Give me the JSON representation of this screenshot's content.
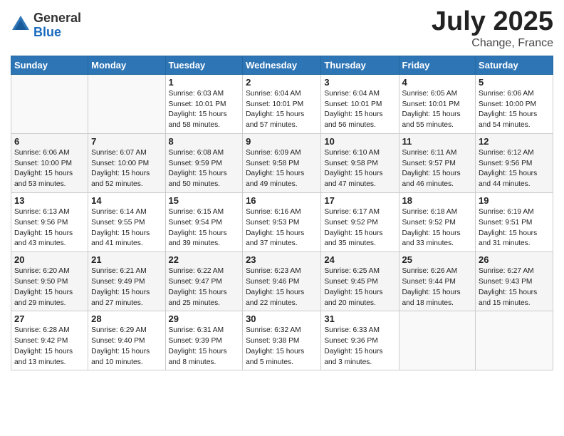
{
  "logo": {
    "general": "General",
    "blue": "Blue"
  },
  "title": "July 2025",
  "subtitle": "Change, France",
  "weekdays": [
    "Sunday",
    "Monday",
    "Tuesday",
    "Wednesday",
    "Thursday",
    "Friday",
    "Saturday"
  ],
  "weeks": [
    [
      {
        "day": "",
        "info": ""
      },
      {
        "day": "",
        "info": ""
      },
      {
        "day": "1",
        "info": "Sunrise: 6:03 AM\nSunset: 10:01 PM\nDaylight: 15 hours\nand 58 minutes."
      },
      {
        "day": "2",
        "info": "Sunrise: 6:04 AM\nSunset: 10:01 PM\nDaylight: 15 hours\nand 57 minutes."
      },
      {
        "day": "3",
        "info": "Sunrise: 6:04 AM\nSunset: 10:01 PM\nDaylight: 15 hours\nand 56 minutes."
      },
      {
        "day": "4",
        "info": "Sunrise: 6:05 AM\nSunset: 10:01 PM\nDaylight: 15 hours\nand 55 minutes."
      },
      {
        "day": "5",
        "info": "Sunrise: 6:06 AM\nSunset: 10:00 PM\nDaylight: 15 hours\nand 54 minutes."
      }
    ],
    [
      {
        "day": "6",
        "info": "Sunrise: 6:06 AM\nSunset: 10:00 PM\nDaylight: 15 hours\nand 53 minutes."
      },
      {
        "day": "7",
        "info": "Sunrise: 6:07 AM\nSunset: 10:00 PM\nDaylight: 15 hours\nand 52 minutes."
      },
      {
        "day": "8",
        "info": "Sunrise: 6:08 AM\nSunset: 9:59 PM\nDaylight: 15 hours\nand 50 minutes."
      },
      {
        "day": "9",
        "info": "Sunrise: 6:09 AM\nSunset: 9:58 PM\nDaylight: 15 hours\nand 49 minutes."
      },
      {
        "day": "10",
        "info": "Sunrise: 6:10 AM\nSunset: 9:58 PM\nDaylight: 15 hours\nand 47 minutes."
      },
      {
        "day": "11",
        "info": "Sunrise: 6:11 AM\nSunset: 9:57 PM\nDaylight: 15 hours\nand 46 minutes."
      },
      {
        "day": "12",
        "info": "Sunrise: 6:12 AM\nSunset: 9:56 PM\nDaylight: 15 hours\nand 44 minutes."
      }
    ],
    [
      {
        "day": "13",
        "info": "Sunrise: 6:13 AM\nSunset: 9:56 PM\nDaylight: 15 hours\nand 43 minutes."
      },
      {
        "day": "14",
        "info": "Sunrise: 6:14 AM\nSunset: 9:55 PM\nDaylight: 15 hours\nand 41 minutes."
      },
      {
        "day": "15",
        "info": "Sunrise: 6:15 AM\nSunset: 9:54 PM\nDaylight: 15 hours\nand 39 minutes."
      },
      {
        "day": "16",
        "info": "Sunrise: 6:16 AM\nSunset: 9:53 PM\nDaylight: 15 hours\nand 37 minutes."
      },
      {
        "day": "17",
        "info": "Sunrise: 6:17 AM\nSunset: 9:52 PM\nDaylight: 15 hours\nand 35 minutes."
      },
      {
        "day": "18",
        "info": "Sunrise: 6:18 AM\nSunset: 9:52 PM\nDaylight: 15 hours\nand 33 minutes."
      },
      {
        "day": "19",
        "info": "Sunrise: 6:19 AM\nSunset: 9:51 PM\nDaylight: 15 hours\nand 31 minutes."
      }
    ],
    [
      {
        "day": "20",
        "info": "Sunrise: 6:20 AM\nSunset: 9:50 PM\nDaylight: 15 hours\nand 29 minutes."
      },
      {
        "day": "21",
        "info": "Sunrise: 6:21 AM\nSunset: 9:49 PM\nDaylight: 15 hours\nand 27 minutes."
      },
      {
        "day": "22",
        "info": "Sunrise: 6:22 AM\nSunset: 9:47 PM\nDaylight: 15 hours\nand 25 minutes."
      },
      {
        "day": "23",
        "info": "Sunrise: 6:23 AM\nSunset: 9:46 PM\nDaylight: 15 hours\nand 22 minutes."
      },
      {
        "day": "24",
        "info": "Sunrise: 6:25 AM\nSunset: 9:45 PM\nDaylight: 15 hours\nand 20 minutes."
      },
      {
        "day": "25",
        "info": "Sunrise: 6:26 AM\nSunset: 9:44 PM\nDaylight: 15 hours\nand 18 minutes."
      },
      {
        "day": "26",
        "info": "Sunrise: 6:27 AM\nSunset: 9:43 PM\nDaylight: 15 hours\nand 15 minutes."
      }
    ],
    [
      {
        "day": "27",
        "info": "Sunrise: 6:28 AM\nSunset: 9:42 PM\nDaylight: 15 hours\nand 13 minutes."
      },
      {
        "day": "28",
        "info": "Sunrise: 6:29 AM\nSunset: 9:40 PM\nDaylight: 15 hours\nand 10 minutes."
      },
      {
        "day": "29",
        "info": "Sunrise: 6:31 AM\nSunset: 9:39 PM\nDaylight: 15 hours\nand 8 minutes."
      },
      {
        "day": "30",
        "info": "Sunrise: 6:32 AM\nSunset: 9:38 PM\nDaylight: 15 hours\nand 5 minutes."
      },
      {
        "day": "31",
        "info": "Sunrise: 6:33 AM\nSunset: 9:36 PM\nDaylight: 15 hours\nand 3 minutes."
      },
      {
        "day": "",
        "info": ""
      },
      {
        "day": "",
        "info": ""
      }
    ]
  ]
}
